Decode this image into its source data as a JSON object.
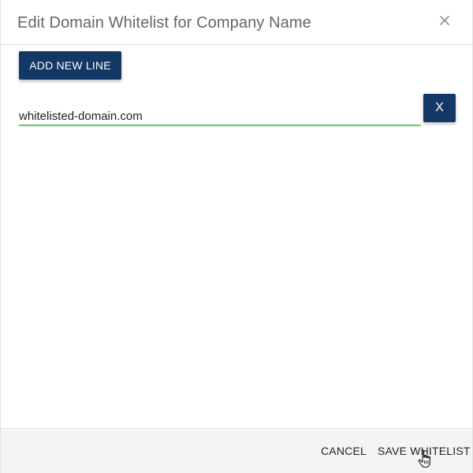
{
  "dialog": {
    "title": "Edit Domain Whitelist for Company Name",
    "close_icon": "close-icon"
  },
  "toolbar": {
    "add_line_label": "ADD NEW LINE"
  },
  "domains": {
    "lines": [
      {
        "value": "whitelisted-domain.com",
        "remove_label": "X"
      }
    ]
  },
  "footer": {
    "cancel_label": "CANCEL",
    "save_label": "SAVE WHITELIST"
  },
  "colors": {
    "primary_button": "#133866",
    "input_focus_underline": "#5ccd6a",
    "footer_background": "#f4f4f4",
    "title_text": "#666666"
  },
  "cursor_icon": "hand-pointer-icon"
}
